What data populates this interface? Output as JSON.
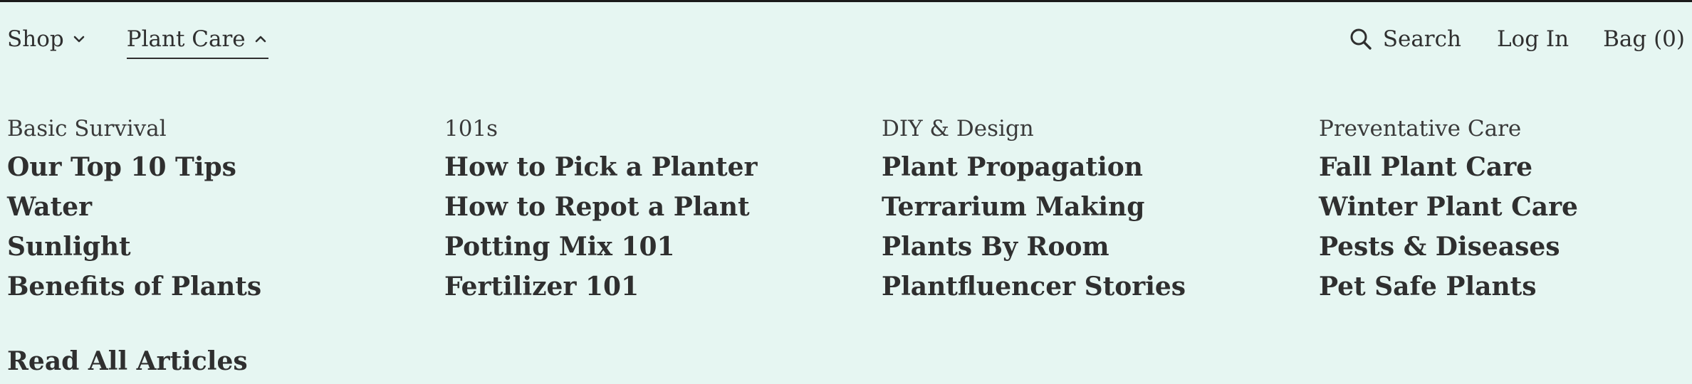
{
  "header": {
    "nav_left": [
      {
        "label": "Shop",
        "expanded": false
      },
      {
        "label": "Plant Care",
        "expanded": true
      }
    ],
    "search_label": "Search",
    "login_label": "Log In",
    "bag_label": "Bag (0)"
  },
  "menu": {
    "columns": [
      {
        "heading": "Basic Survival",
        "links": [
          "Our Top 10 Tips",
          "Water",
          "Sunlight",
          "Benefits of Plants"
        ]
      },
      {
        "heading": "101s",
        "links": [
          "How to Pick a Planter",
          "How to Repot a Plant",
          "Potting Mix 101",
          "Fertilizer 101"
        ]
      },
      {
        "heading": "DIY & Design",
        "links": [
          "Plant Propagation",
          "Terrarium Making",
          "Plants By Room",
          "Plantfluencer Stories"
        ]
      },
      {
        "heading": "Preventative Care",
        "links": [
          "Fall Plant Care",
          "Winter Plant Care",
          "Pests & Diseases",
          "Pet Safe Plants"
        ]
      }
    ],
    "read_all_label": "Read All Articles"
  },
  "colors": {
    "background": "#e6f6f2",
    "text": "#2f2f2f",
    "topbar": "#1b1b1b"
  }
}
